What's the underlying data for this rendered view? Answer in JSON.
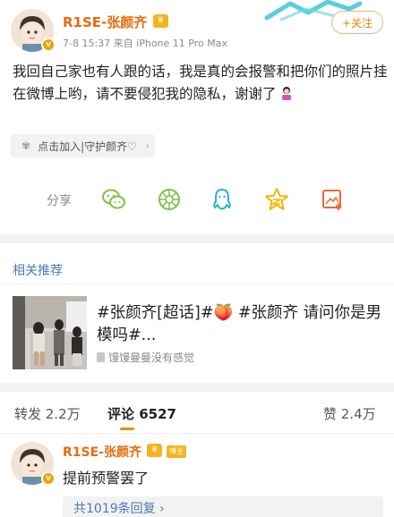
{
  "post": {
    "username": "R1SE-张颜齐",
    "meta": "7-8 15:37  来自 iPhone 11 Pro Max",
    "follow_label": "+关注",
    "text": "我回自己家也有人跟的话，我是真的会报警和把你们的照片挂在微博上哟，请不要侵犯我的隐私，谢谢了",
    "guard_tag": "点击加入|守护颜齐♡"
  },
  "share": {
    "label": "分享",
    "icons": [
      "wechat-icon",
      "moments-icon",
      "qq-icon",
      "qzone-icon",
      "save-image-icon"
    ]
  },
  "related": {
    "title": "相关推荐",
    "headline": "#张颜齐[超话]#🍑 #张颜齐 请问你是男模吗#...",
    "source": "馒馒曼曼没有感觉"
  },
  "stats": {
    "reposts": "转发 2.2万",
    "comments": "评论 6527",
    "likes": "赞 2.4万"
  },
  "comment": {
    "username": "R1SE-张颜齐",
    "badge": "博主",
    "text": "提前预警罢了",
    "replies": "共1019条回复 ›"
  },
  "colors": {
    "username_orange": "#e86b0a",
    "link_blue": "#4a7ab5",
    "share_green": "#7cc243",
    "share_yellow": "#f4b400",
    "share_teal": "#29b3d4"
  }
}
